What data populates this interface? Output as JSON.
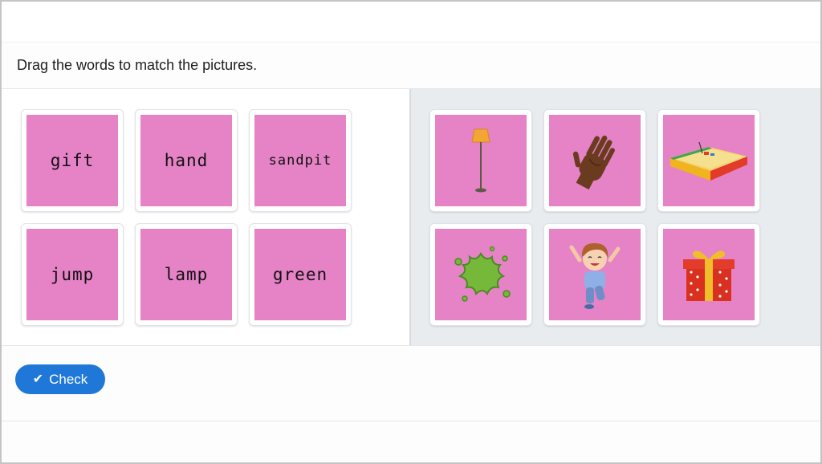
{
  "instruction": "Drag the words to match the pictures.",
  "words": [
    {
      "label": "gift"
    },
    {
      "label": "hand"
    },
    {
      "label": "sandpit"
    },
    {
      "label": "jump"
    },
    {
      "label": "lamp"
    },
    {
      "label": "green"
    }
  ],
  "pictures": [
    {
      "icon": "lamp-icon"
    },
    {
      "icon": "hand-icon"
    },
    {
      "icon": "sandpit-icon"
    },
    {
      "icon": "green-splat-icon"
    },
    {
      "icon": "jumping-child-icon"
    },
    {
      "icon": "gift-box-icon"
    }
  ],
  "check_button": {
    "label": "Check",
    "icon": "checkmark-icon"
  },
  "colors": {
    "card_fill": "#e583c6",
    "button": "#1f78d8",
    "pictures_panel": "#e9ecef"
  }
}
